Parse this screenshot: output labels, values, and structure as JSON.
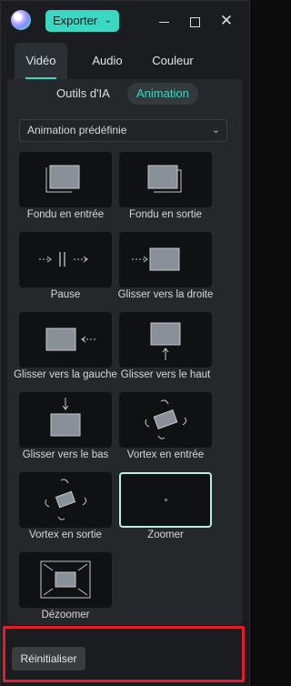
{
  "titlebar": {
    "export_label": "Exporter",
    "export_chevron": "⌄",
    "close_glyph": "✕"
  },
  "tabs": [
    {
      "label": "Vidéo",
      "active": true
    },
    {
      "label": "Audio",
      "active": false
    },
    {
      "label": "Couleur",
      "active": false
    }
  ],
  "subtabs": [
    {
      "label": "Outils d'IA",
      "active": false
    },
    {
      "label": "Animation",
      "active": true
    }
  ],
  "dropdown": {
    "value": "Animation prédéfinie",
    "chevron": "⌄"
  },
  "presets": [
    {
      "label": "Fondu en entrée",
      "icon": "fade-in-icon"
    },
    {
      "label": "Fondu en sortie",
      "icon": "fade-out-icon"
    },
    {
      "label": "Pause",
      "icon": "pause-icon"
    },
    {
      "label": "Glisser vers la droite",
      "icon": "slide-right-icon"
    },
    {
      "label": "Glisser vers la gauche",
      "icon": "slide-left-icon"
    },
    {
      "label": "Glisser vers le haut",
      "icon": "slide-up-icon"
    },
    {
      "label": "Glisser vers le bas",
      "icon": "slide-down-icon"
    },
    {
      "label": "Vortex en entrée",
      "icon": "vortex-in-icon"
    },
    {
      "label": "Vortex en sortie",
      "icon": "vortex-out-icon"
    },
    {
      "label": "Zoomer",
      "icon": "zoom-in-icon",
      "selected": true
    },
    {
      "label": "Dézoomer",
      "icon": "zoom-out-icon"
    }
  ],
  "reset_label": "Réinitialiser",
  "colors": {
    "accent": "#38d8c2",
    "highlight": "#e31e2b",
    "panel": "#25282b"
  }
}
